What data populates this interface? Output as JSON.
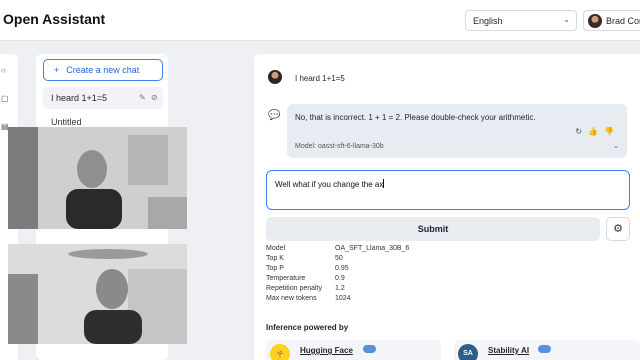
{
  "app": {
    "title": "Open Assistant"
  },
  "header": {
    "language": "English",
    "user_name": "Brad Cor"
  },
  "sidebar": {
    "new_chat_label": "Create a new chat",
    "new_chat_icon": "+",
    "chats": [
      {
        "title": "I heard 1+1=5"
      },
      {
        "title": "Untitled"
      }
    ]
  },
  "conversation": {
    "user_message": "I heard 1+1=5",
    "assistant_message": "No, that is incorrect. 1 + 1 = 2. Please double-check your arithmetic.",
    "assistant_model": "Model: oasst-sft-6-llama-30b"
  },
  "composer": {
    "value": "Well what if you change the ax",
    "submit_label": "Submit"
  },
  "params": [
    {
      "key": "Model",
      "value": "OA_SFT_Llama_30B_6"
    },
    {
      "key": "Top K",
      "value": "50"
    },
    {
      "key": "Top P",
      "value": "0.95"
    },
    {
      "key": "Temperature",
      "value": "0.9"
    },
    {
      "key": "Repetition penalty",
      "value": "1.2"
    },
    {
      "key": "Max new tokens",
      "value": "1024"
    }
  ],
  "inference": {
    "heading": "Inference powered by",
    "sponsors": [
      {
        "name": "Hugging Face",
        "logo": "🤗"
      },
      {
        "name": "Stability AI",
        "logo": "SA"
      }
    ]
  },
  "colors": {
    "accent": "#3b82f6",
    "bg": "#eef0f4",
    "assistant_bubble": "#e7ecf3"
  }
}
